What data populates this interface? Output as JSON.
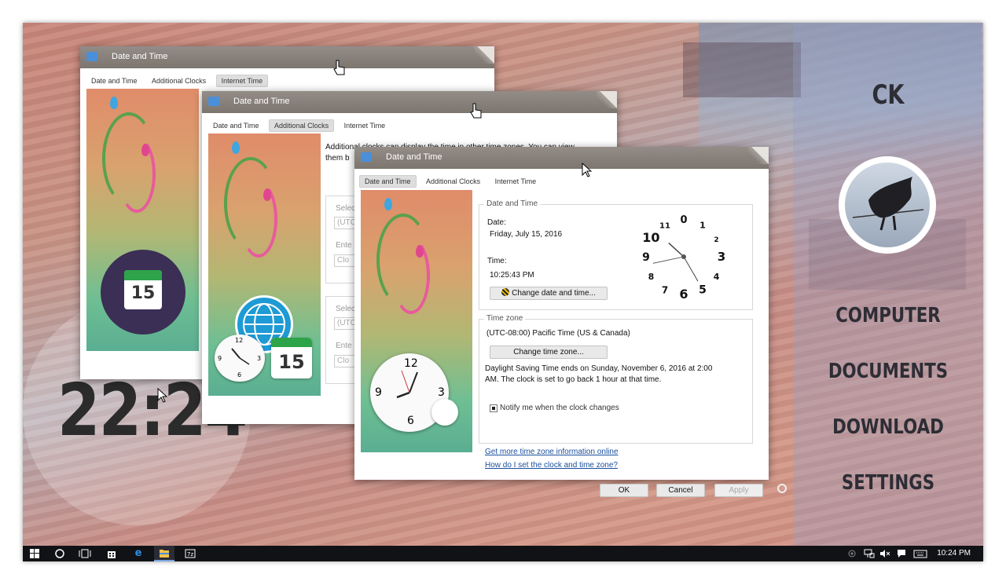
{
  "desktop": {
    "big_clock": "22:24",
    "side_panel": {
      "title": "CK",
      "links": [
        "COMPUTER",
        "DOCUMENTS",
        "DOWNLOAD",
        "SETTINGS"
      ]
    }
  },
  "windows": [
    {
      "title": "Date and Time",
      "tabs": [
        "Date and Time",
        "Additional Clocks",
        "Internet Time"
      ],
      "selected_tab": "Internet Time",
      "calendar_badge": "15"
    },
    {
      "title": "Date and Time",
      "tabs": [
        "Date and Time",
        "Additional Clocks",
        "Internet Time"
      ],
      "selected_tab": "Additional Clocks",
      "intro_line1": "Additional clocks can display the time in other time zones. You can view",
      "intro_line2": "them b",
      "sel1": "Selec",
      "utc1": "(UTC",
      "enter1": "Ente",
      "clk1": "Clo",
      "sel2": "Selec",
      "utc2": "(UTC",
      "enter2": "Ente",
      "clk2": "Clo",
      "mini_clock": {
        "n12": "12",
        "n3": "3",
        "n6": "6",
        "n9": "9"
      },
      "calendar_badge": "15"
    },
    {
      "title": "Date and Time",
      "tabs": [
        "Date and Time",
        "Additional Clocks",
        "Internet Time"
      ],
      "selected_tab": "Date and Time",
      "date_time_group": {
        "label": "Date and Time",
        "date_label": "Date:",
        "date_value": "Friday, July 15, 2016",
        "time_label": "Time:",
        "time_value": "10:25:43 PM",
        "change_button": "Change date and time..."
      },
      "analog_clock": {
        "numerals": [
          "0",
          "1",
          "2",
          "3",
          "4",
          "5",
          "6",
          "7",
          "8",
          "9",
          "10",
          "11"
        ],
        "hour": 10,
        "minute": 25,
        "second": 43
      },
      "time_zone_group": {
        "label": "Time zone",
        "zone": "(UTC-08:00) Pacific Time (US & Canada)",
        "change_button": "Change time zone...",
        "dst_line1": "Daylight Saving Time ends on Sunday, November 6, 2016 at 2:00",
        "dst_line2": "AM. The clock is set to go back 1 hour at that time.",
        "notify_label": "Notify me when the clock changes"
      },
      "links": [
        "Get more time zone information online",
        "How do I set the clock and time zone?"
      ],
      "footer_buttons": {
        "ok": "OK",
        "cancel": "Cancel",
        "apply": "Apply"
      },
      "art_clock": {
        "n12": "12",
        "n3": "3",
        "n6": "6",
        "n9": "9"
      }
    }
  ],
  "taskbar": {
    "clock": "10:24 PM",
    "icons": [
      "windows-start-icon",
      "cortana-circle-icon",
      "task-view-icon",
      "store-icon",
      "edge-icon",
      "file-explorer-icon",
      "7zip-icon"
    ]
  },
  "colors": {
    "taskbar": "#111216",
    "titlebar": "#8a837d",
    "link": "#1b4f9e",
    "side_panel_text": "#2d2d35"
  }
}
